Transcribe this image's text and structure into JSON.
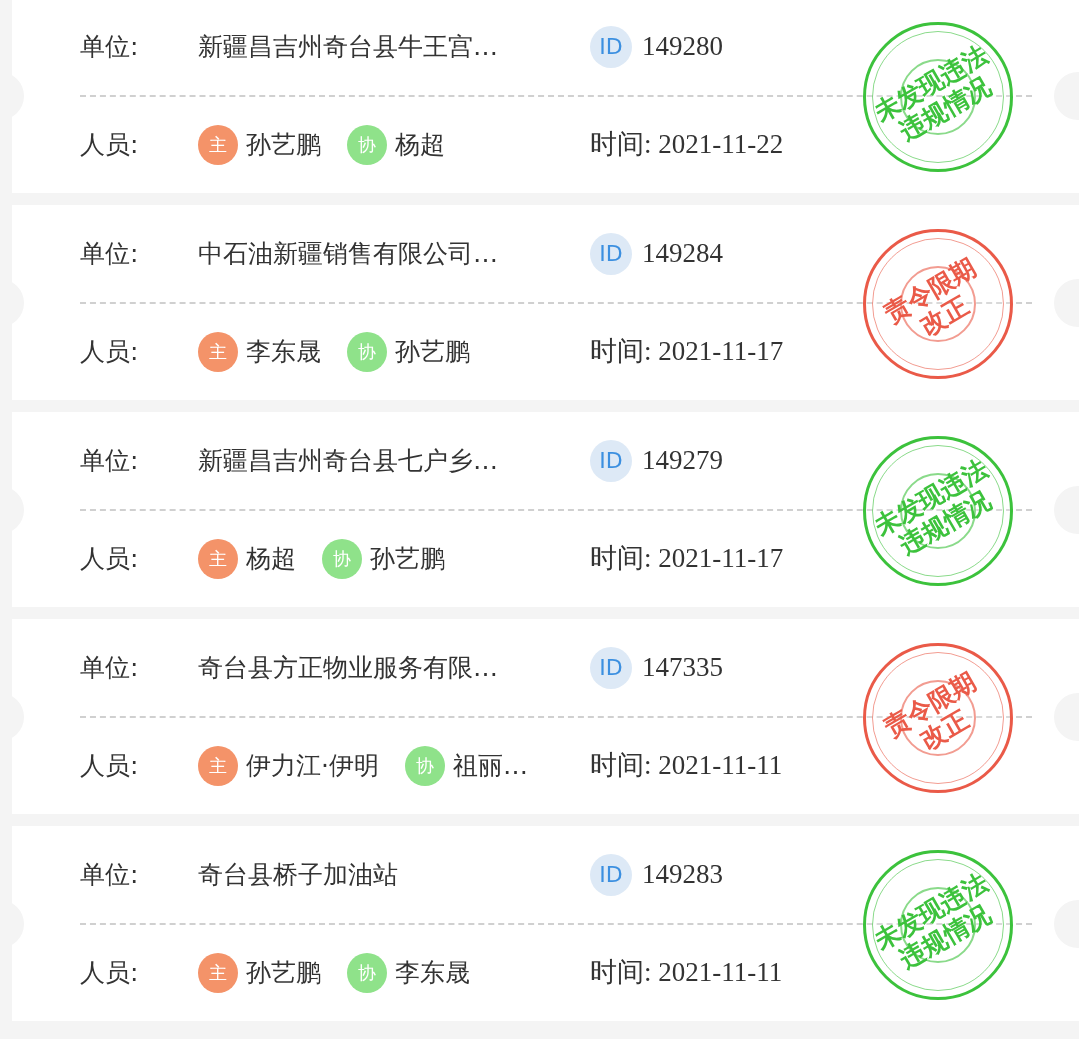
{
  "records": [
    {
      "unit_label": "单位:",
      "unit": "新疆昌吉州奇台县牛王宫…",
      "id_badge": "ID",
      "id": "149280",
      "staff_label": "人员:",
      "staff": [
        {
          "role": "主",
          "kind": "lead",
          "name": "孙艺鹏"
        },
        {
          "role": "协",
          "kind": "assist",
          "name": "杨超"
        }
      ],
      "time": "时间: 2021-11-22",
      "stamp": {
        "kind": "pass",
        "lines": [
          "未发现违法",
          "违规情况"
        ]
      }
    },
    {
      "unit_label": "单位:",
      "unit": "中石油新疆销售有限公司…",
      "id_badge": "ID",
      "id": "149284",
      "staff_label": "人员:",
      "staff": [
        {
          "role": "主",
          "kind": "lead",
          "name": "李东晟"
        },
        {
          "role": "协",
          "kind": "assist",
          "name": "孙艺鹏"
        }
      ],
      "time": "时间: 2021-11-17",
      "stamp": {
        "kind": "rectify",
        "lines": [
          "责令限期",
          "改正"
        ]
      }
    },
    {
      "unit_label": "单位:",
      "unit": "新疆昌吉州奇台县七户乡…",
      "id_badge": "ID",
      "id": "149279",
      "staff_label": "人员:",
      "staff": [
        {
          "role": "主",
          "kind": "lead",
          "name": "杨超"
        },
        {
          "role": "协",
          "kind": "assist",
          "name": "孙艺鹏"
        }
      ],
      "time": "时间: 2021-11-17",
      "stamp": {
        "kind": "pass",
        "lines": [
          "未发现违法",
          "违规情况"
        ]
      }
    },
    {
      "unit_label": "单位:",
      "unit": "奇台县方正物业服务有限…",
      "id_badge": "ID",
      "id": "147335",
      "staff_label": "人员:",
      "staff": [
        {
          "role": "主",
          "kind": "lead",
          "name": "伊力江·伊明"
        },
        {
          "role": "协",
          "kind": "assist",
          "name": "祖丽…"
        }
      ],
      "time": "时间: 2021-11-11",
      "stamp": {
        "kind": "rectify",
        "lines": [
          "责令限期",
          "改正"
        ]
      }
    },
    {
      "unit_label": "单位:",
      "unit": "奇台县桥子加油站",
      "id_badge": "ID",
      "id": "149283",
      "staff_label": "人员:",
      "staff": [
        {
          "role": "主",
          "kind": "lead",
          "name": "孙艺鹏"
        },
        {
          "role": "协",
          "kind": "assist",
          "name": "李东晟"
        }
      ],
      "time": "时间: 2021-11-11",
      "stamp": {
        "kind": "pass",
        "lines": [
          "未发现违法",
          "违规情况"
        ]
      }
    }
  ]
}
